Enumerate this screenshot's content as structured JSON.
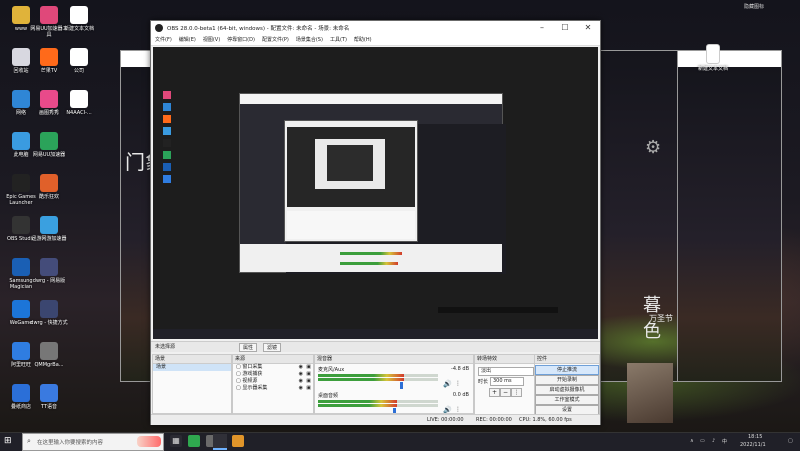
{
  "desktop": {
    "icons": [
      {
        "label": "www",
        "color": "#e0b33a"
      },
      {
        "label": "回收站",
        "color": "#d8d8e0"
      },
      {
        "label": "网络",
        "color": "#2f86d6"
      },
      {
        "label": "此电脑",
        "color": "#3a9be0"
      },
      {
        "label": "Epic Games Launcher",
        "color": "#222222"
      },
      {
        "label": "OBS Studio",
        "color": "#333333"
      },
      {
        "label": "Samsung Magician",
        "color": "#1a5fb4"
      },
      {
        "label": "WeGame",
        "color": "#1c75d8"
      },
      {
        "label": "阿里旺旺",
        "color": "#2f7de1"
      },
      {
        "label": "叠纸商店",
        "color": "#2b6fd8"
      }
    ],
    "icons_col2": [
      {
        "label": "网易UU加速器工具",
        "color": "#e0487a"
      },
      {
        "label": "芒果TV",
        "color": "#ff6a1a"
      },
      {
        "label": "画图秀秀",
        "color": "#e84a8a"
      },
      {
        "label": "网易UU加速器",
        "color": "#2ba35a"
      },
      {
        "label": "酷乐狂欢",
        "color": "#e0602a"
      },
      {
        "label": "迅游网游加速器",
        "color": "#3aa0e0"
      },
      {
        "label": "dwrg - 网易版",
        "color": "#444c7a"
      },
      {
        "label": "dwrg - 快捷方式",
        "color": "#3b4670"
      },
      {
        "label": "QMMgrBa...",
        "color": "#777777"
      },
      {
        "label": "TT语音",
        "color": "#3a7ae0"
      }
    ],
    "icons_col3": [
      {
        "label": "新建文本文档",
        "color": "#ffffff"
      },
      {
        "label": "公司",
        "color": "#ffffff"
      },
      {
        "label": "N4AACI-...",
        "color": "#ffffff"
      }
    ],
    "right_icon": {
      "label": "新建文本文档"
    },
    "top_right_label": "隐藏图标",
    "big_text_1": "暮色",
    "big_text_2": "万圣节",
    "mid_text": "暮色",
    "left_partial_text": "门象"
  },
  "obs": {
    "title": "OBS 28.0.0-beta1 (64-bit, windows) - 配置文件: 未命名 - 场景: 未命名",
    "menu": [
      "文件(F)",
      "编辑(E)",
      "视图(V)",
      "停靠窗口(D)",
      "配置文件(P)",
      "场景集合(S)",
      "工具(T)",
      "帮助(H)"
    ],
    "scene_selector_label": "未选择源",
    "scene_selector_buttons": [
      "属性",
      "滤镜"
    ],
    "docks": {
      "scenes": {
        "title": "场景",
        "items": [
          "场景"
        ]
      },
      "sources": {
        "title": "来源",
        "items": [
          "窗口采集",
          "游戏捕获",
          "视频源",
          "显示器采集"
        ]
      },
      "mixer": {
        "title": "混音器",
        "channels": [
          {
            "name": "麦克风/Aux",
            "db": "-4.8 dB",
            "level": 0.72
          },
          {
            "name": "桌面音频",
            "db": "0.0 dB",
            "level": 0.66
          }
        ]
      },
      "transitions": {
        "title": "转场特效",
        "type": "淡出",
        "duration_label": "时长",
        "duration": "300 ms"
      },
      "controls": {
        "title": "控件",
        "buttons": [
          "停止推流",
          "开始录制",
          "启动虚拟摄像机",
          "工作室模式",
          "设置",
          "退出"
        ]
      }
    },
    "status": {
      "live": "LIVE: 00:00:00",
      "rec": "REC: 00:00:00",
      "cpu": "CPU: 1.8%, 60.00 fps"
    }
  },
  "taskbar": {
    "search_placeholder": "在这里输入你要搜索的内容",
    "time": "18:15",
    "date": "2022/11/1",
    "ime": "中"
  }
}
